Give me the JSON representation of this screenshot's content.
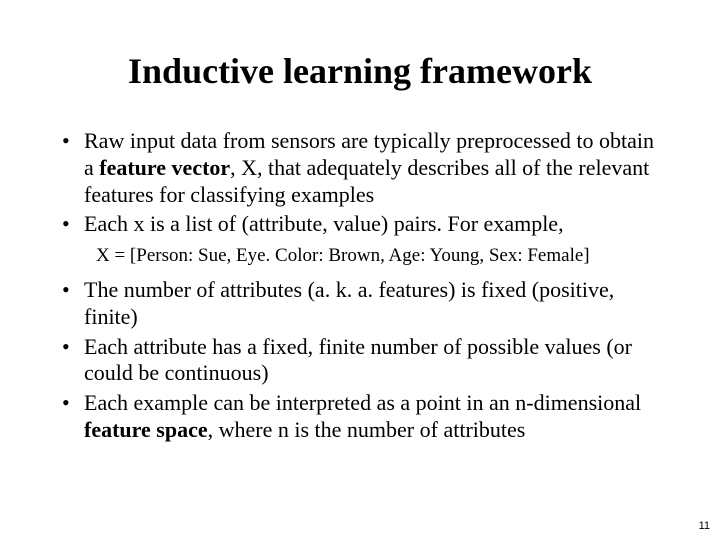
{
  "title": "Inductive learning framework",
  "bullets": {
    "b1_pre": "Raw input data from sensors are typically preprocessed to obtain a ",
    "b1_bold": "feature vector",
    "b1_post": ", X, that adequately describes all of the relevant features for classifying examples",
    "b2": "Each x is a list of (attribute, value) pairs. For example,",
    "example": "X = [Person: Sue,  Eye. Color: Brown,  Age: Young,  Sex: Female]",
    "b3": "The number of attributes (a. k. a.  features) is fixed (positive, finite)",
    "b4": "Each attribute has a fixed, finite number of possible values (or could be continuous)",
    "b5_pre": "Each example can be interpreted as a point in an n-dimensional ",
    "b5_bold": "feature space",
    "b5_post": ", where n is the number of attributes"
  },
  "pagenum": "11"
}
